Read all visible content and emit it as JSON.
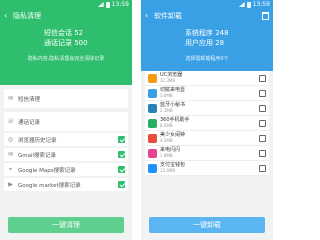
{
  "left": {
    "status_time": "13:59",
    "title": "隐私清理",
    "stats": [
      "短信会话 52",
      "通话记录 500"
    ],
    "note": "隐私内容,隐私清理会完全清除记录",
    "rows": [
      {
        "label": "短信清理",
        "icon": "message-icon",
        "glyph": "✉",
        "checked": null
      },
      {
        "label": "通话记录",
        "icon": "phone-icon",
        "glyph": "☏",
        "checked": null
      },
      {
        "label": "浏览器历史记录",
        "icon": "browser-icon",
        "glyph": "◎",
        "checked": true
      },
      {
        "label": "Gmail搜索记录",
        "icon": "gmail-icon",
        "glyph": "✉",
        "checked": true
      },
      {
        "label": "Google Maps搜索记录",
        "icon": "maps-icon",
        "glyph": "⌖",
        "checked": true
      },
      {
        "label": "Google market搜索记录",
        "icon": "market-icon",
        "glyph": "▶",
        "checked": true
      }
    ],
    "button": "一键清理"
  },
  "right": {
    "status_time": "13:59",
    "title": "软件卸载",
    "stats": [
      "系统程序 248",
      "用户应用 28"
    ],
    "note": "选择需卸载程序0个",
    "apps": [
      {
        "name": "UC浏览器",
        "size": "12.3MB",
        "color": "#f39c12"
      },
      {
        "name": "切腻来电显",
        "size": "3.6MB",
        "color": "#3aa0e6"
      },
      {
        "name": "蓝牙小秘书",
        "size": "2.1MB",
        "color": "#2980b9"
      },
      {
        "name": "360手机助手",
        "size": "8.5MB",
        "color": "#27ae60"
      },
      {
        "name": "美少女闹钟",
        "size": "4.2MB",
        "color": "#e74c3c"
      },
      {
        "name": "来电闪闪",
        "size": "1.8MB",
        "color": "#e84393"
      },
      {
        "name": "支付宝钱包",
        "size": "15.6MB",
        "color": "#1e90ff"
      }
    ],
    "button": "一键卸载"
  }
}
